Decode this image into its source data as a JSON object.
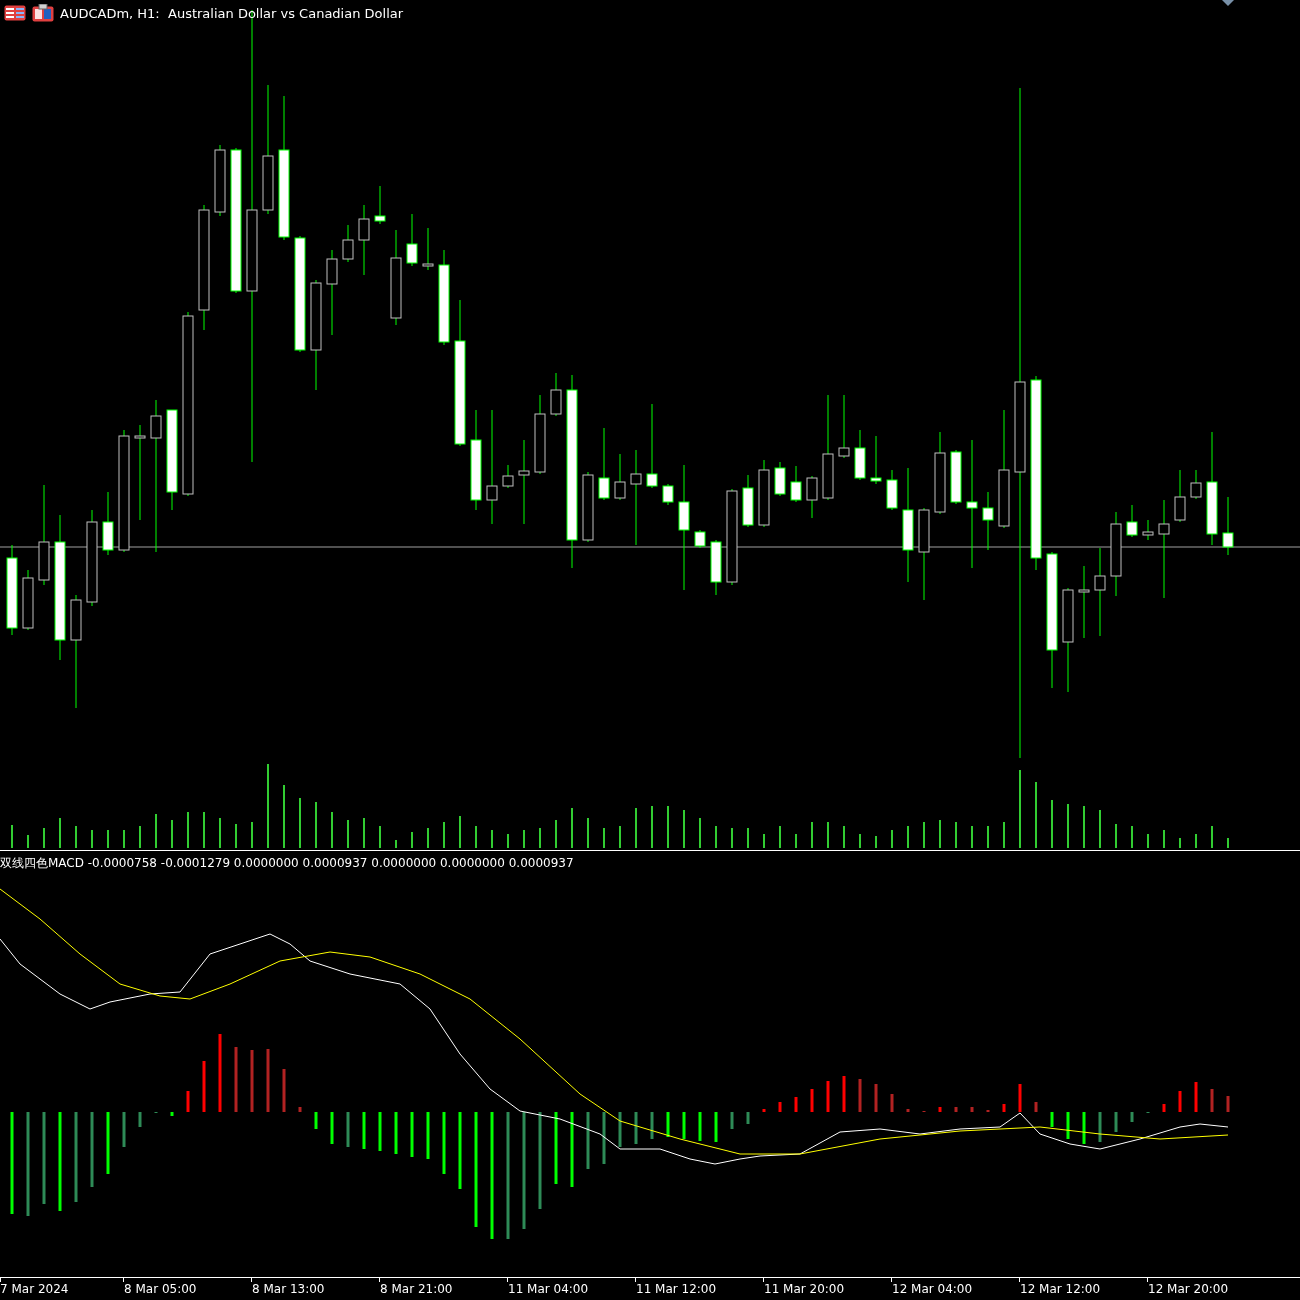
{
  "window": {
    "title": "AUDCADm, H1:  Australian Dollar vs Canadian Dollar"
  },
  "indicator": {
    "label": "双线四色MACD -0.0000758 -0.0001279 0.0000000 0.0000937 0.0000000 0.0000000 0.0000937"
  },
  "time_axis": {
    "labels": [
      "7 Mar 2024",
      "8 Mar 05:00",
      "8 Mar 13:00",
      "8 Mar 21:00",
      "11 Mar 04:00",
      "11 Mar 12:00",
      "11 Mar 20:00",
      "12 Mar 04:00",
      "12 Mar 12:00",
      "12 Mar 20:00"
    ]
  }
}
